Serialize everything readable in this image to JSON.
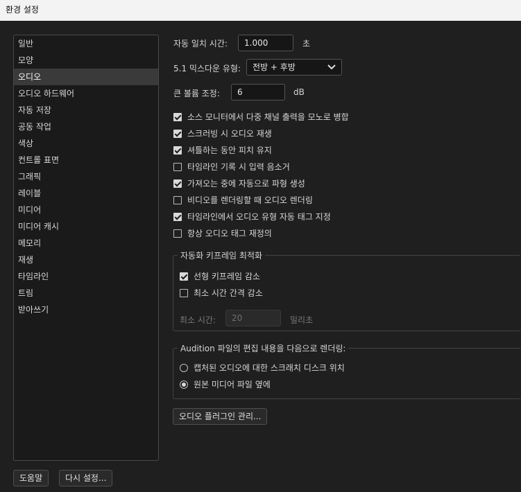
{
  "window": {
    "title": "환경 설정"
  },
  "sidebar": {
    "items": [
      {
        "label": "일반"
      },
      {
        "label": "모양"
      },
      {
        "label": "오디오"
      },
      {
        "label": "오디오 하드웨어"
      },
      {
        "label": "자동 저장"
      },
      {
        "label": "공동 작업"
      },
      {
        "label": "색상"
      },
      {
        "label": "컨트롤 표면"
      },
      {
        "label": "그래픽"
      },
      {
        "label": "레이블"
      },
      {
        "label": "미디어"
      },
      {
        "label": "미디어 캐시"
      },
      {
        "label": "메모리"
      },
      {
        "label": "재생"
      },
      {
        "label": "타임라인"
      },
      {
        "label": "트림"
      },
      {
        "label": "받아쓰기"
      }
    ],
    "selected": "오디오"
  },
  "audio": {
    "automatch_label": "자동 일치 시간:",
    "automatch_value": "1.000",
    "automatch_unit": "초",
    "downmix_label": "5.1 믹스다운 유형:",
    "downmix_value": "전방 + 후방",
    "volume_label": "큰 볼륨 조정:",
    "volume_value": "6",
    "volume_unit": "dB",
    "checkboxes": [
      {
        "label": "소스 모니터에서 다중 채널 출력을 모노로 병합",
        "checked": true
      },
      {
        "label": "스크러빙 시 오디오 재생",
        "checked": true
      },
      {
        "label": "셔틀하는 동안 피치 유지",
        "checked": true
      },
      {
        "label": "타임라인 기록 시 입력 음소거",
        "checked": false
      },
      {
        "label": "가져오는 중에 자동으로 파형 생성",
        "checked": true
      },
      {
        "label": "비디오를 렌더링할 때 오디오 렌더링",
        "checked": false
      },
      {
        "label": "타임라인에서 오디오 유형 자동 태그 지정",
        "checked": true
      },
      {
        "label": "항상 오디오 태그 재정의",
        "checked": false
      }
    ],
    "keyframe_group": {
      "title": "자동화 키프레임 최적화",
      "options": [
        {
          "label": "선형 키프레임 감소",
          "checked": true
        },
        {
          "label": "최소 시간 간격 감소",
          "checked": false
        }
      ],
      "min_time_label": "최소 시간:",
      "min_time_value": "20",
      "min_time_unit": "밀리초"
    },
    "audition_group": {
      "title": "Audition 파일의 편집 내용을 다음으로 렌더링:",
      "options": [
        {
          "label": "캡처된 오디오에 대한 스크래치 디스크 위치",
          "selected": false
        },
        {
          "label": "원본 미디어 파일 옆에",
          "selected": true
        }
      ]
    },
    "plugin_manager_label": "오디오 플러그인 관리..."
  },
  "footer": {
    "help_label": "도움말",
    "reset_label": "다시 설정..."
  }
}
